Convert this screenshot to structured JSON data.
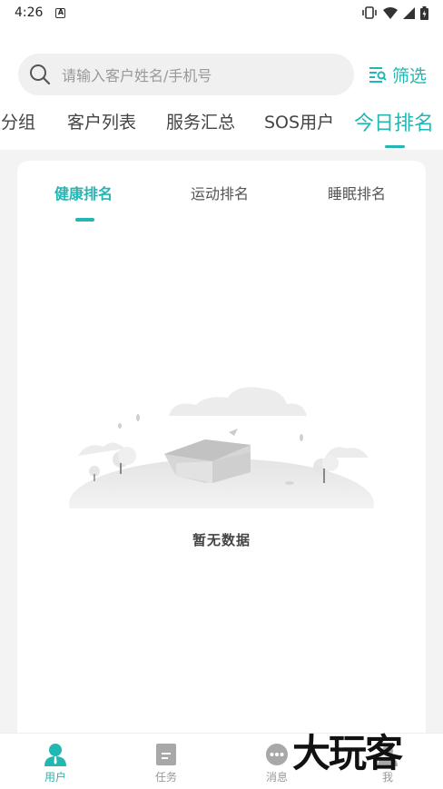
{
  "status_bar": {
    "time": "4:26",
    "badge": "A"
  },
  "search": {
    "placeholder": "请输入客户姓名/手机号"
  },
  "filter": {
    "label": "筛选"
  },
  "tabs": [
    {
      "label": "医分组"
    },
    {
      "label": "客户列表"
    },
    {
      "label": "服务汇总"
    },
    {
      "label": "SOS用户"
    },
    {
      "label": "今日排名"
    }
  ],
  "sub_tabs": [
    {
      "label": "健康排名"
    },
    {
      "label": "运动排名"
    },
    {
      "label": "睡眠排名"
    }
  ],
  "empty_state": {
    "text": "暂无数据"
  },
  "bottom_nav": [
    {
      "label": "用户",
      "icon": "user-icon"
    },
    {
      "label": "任务",
      "icon": "task-icon"
    },
    {
      "label": "消息",
      "icon": "message-icon"
    },
    {
      "label": "我",
      "icon": "me-icon"
    }
  ],
  "watermark": {
    "text": "大玩客"
  },
  "colors": {
    "accent": "#22b7b3",
    "background": "#f3f3f3"
  }
}
